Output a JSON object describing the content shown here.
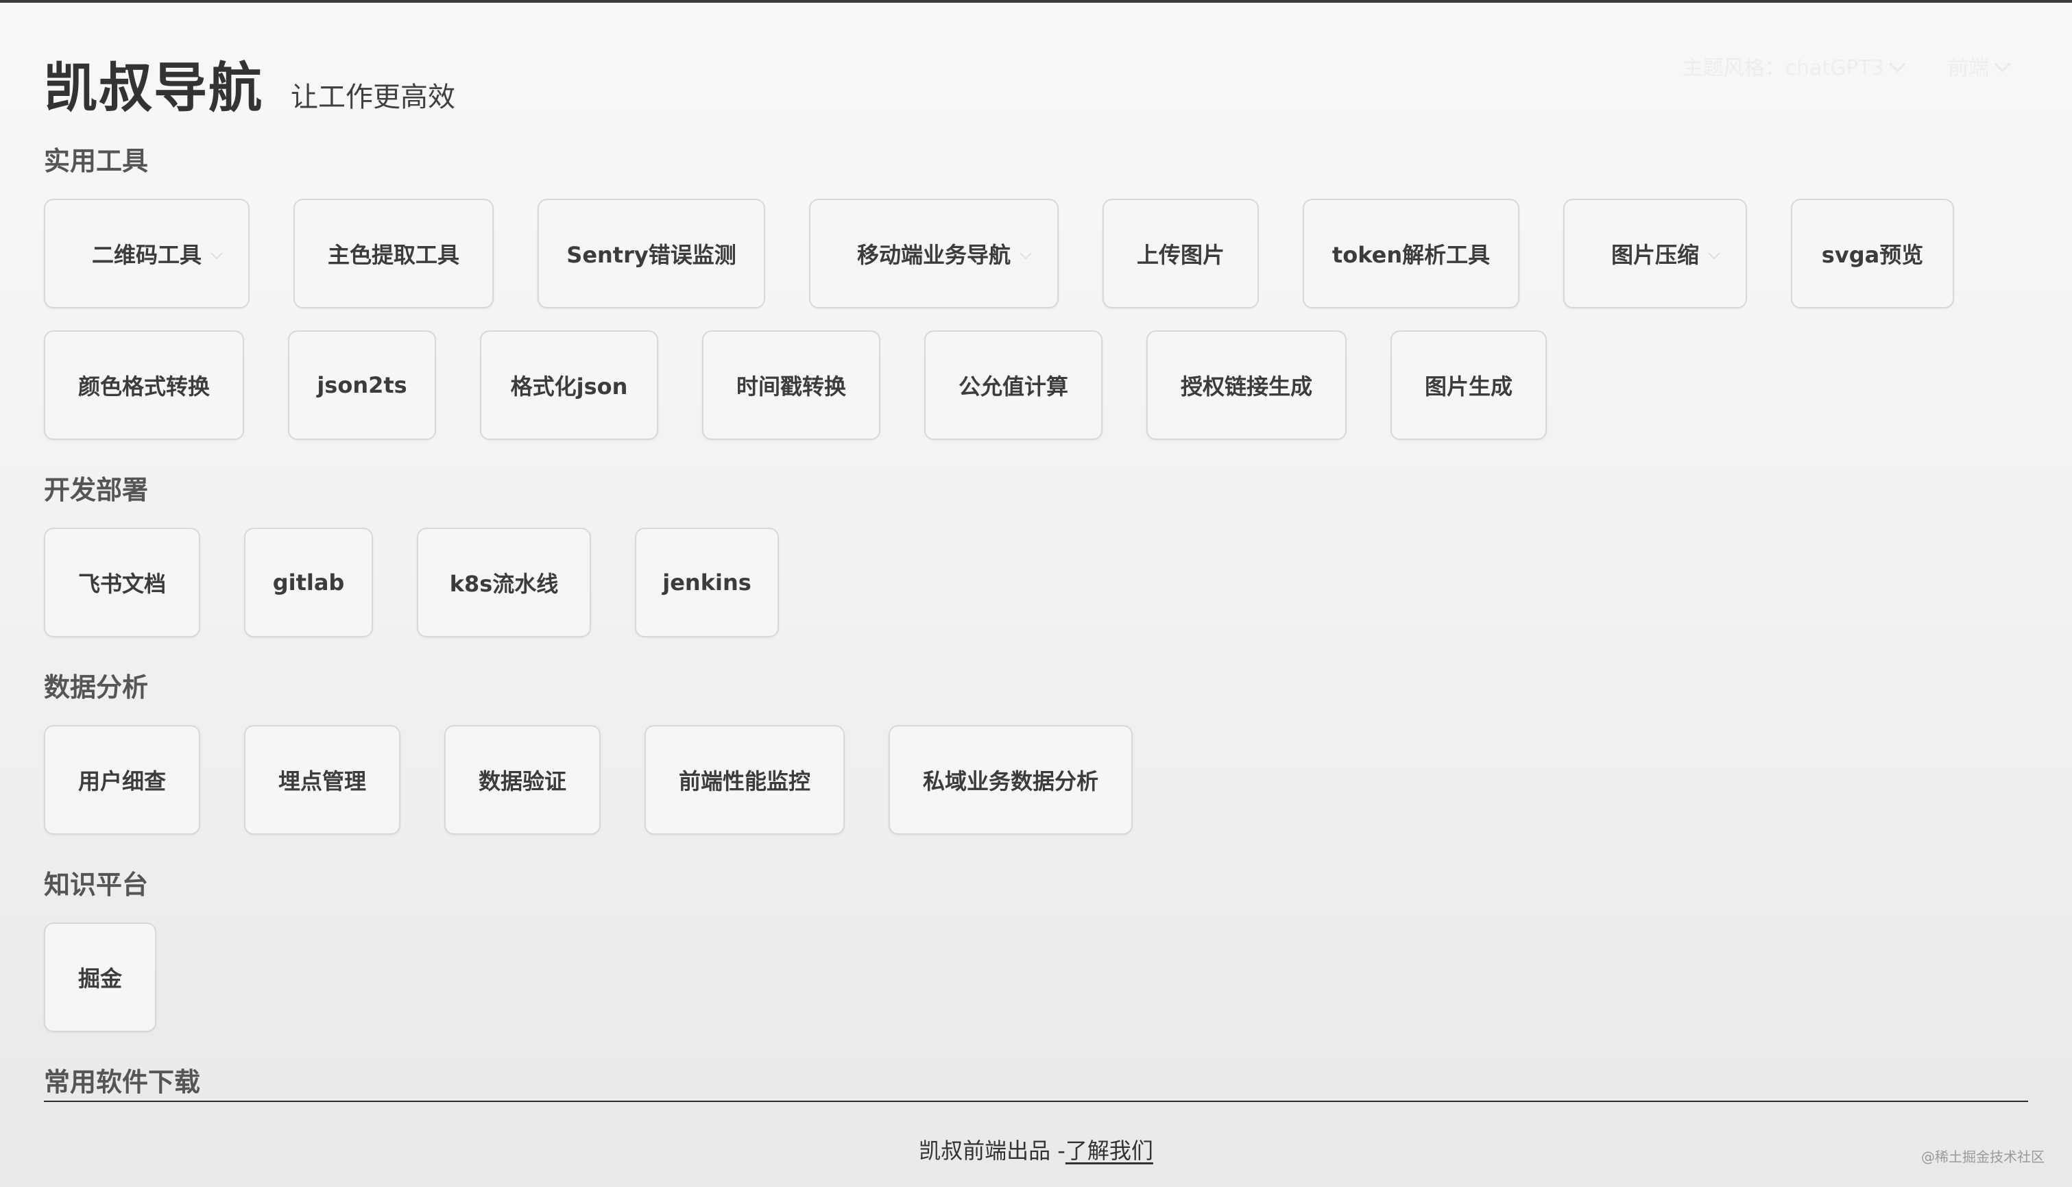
{
  "header": {
    "title": "凯叔导航",
    "subtitle": "让工作更高效"
  },
  "controls": {
    "theme_label": "主题风格：chatGPT3",
    "category_label": "前端"
  },
  "sections": [
    {
      "title": "实用工具",
      "rows": [
        [
          "二维码工具",
          "主色提取工具",
          "Sentry错误监测",
          "移动端业务导航",
          "上传图片",
          "token解析工具",
          "图片压缩",
          "svga预览"
        ],
        [
          "颜色格式转换",
          "json2ts",
          "格式化json",
          "时间戳转换",
          "公允值计算",
          "授权链接生成",
          "图片生成"
        ]
      ]
    },
    {
      "title": "开发部署",
      "rows": [
        [
          "飞书文档",
          "gitlab",
          "k8s流水线",
          "jenkins"
        ]
      ]
    },
    {
      "title": "数据分析",
      "rows": [
        [
          "用户细查",
          "埋点管理",
          "数据验证",
          "前端性能监控",
          "私域业务数据分析"
        ]
      ]
    },
    {
      "title": "知识平台",
      "rows": [
        [
          "掘金"
        ]
      ]
    },
    {
      "title": "常用软件下载",
      "rows": []
    }
  ],
  "footer": {
    "text": "凯叔前端出品 -",
    "link": "了解我们"
  },
  "watermark": "@稀土掘金技术社区"
}
